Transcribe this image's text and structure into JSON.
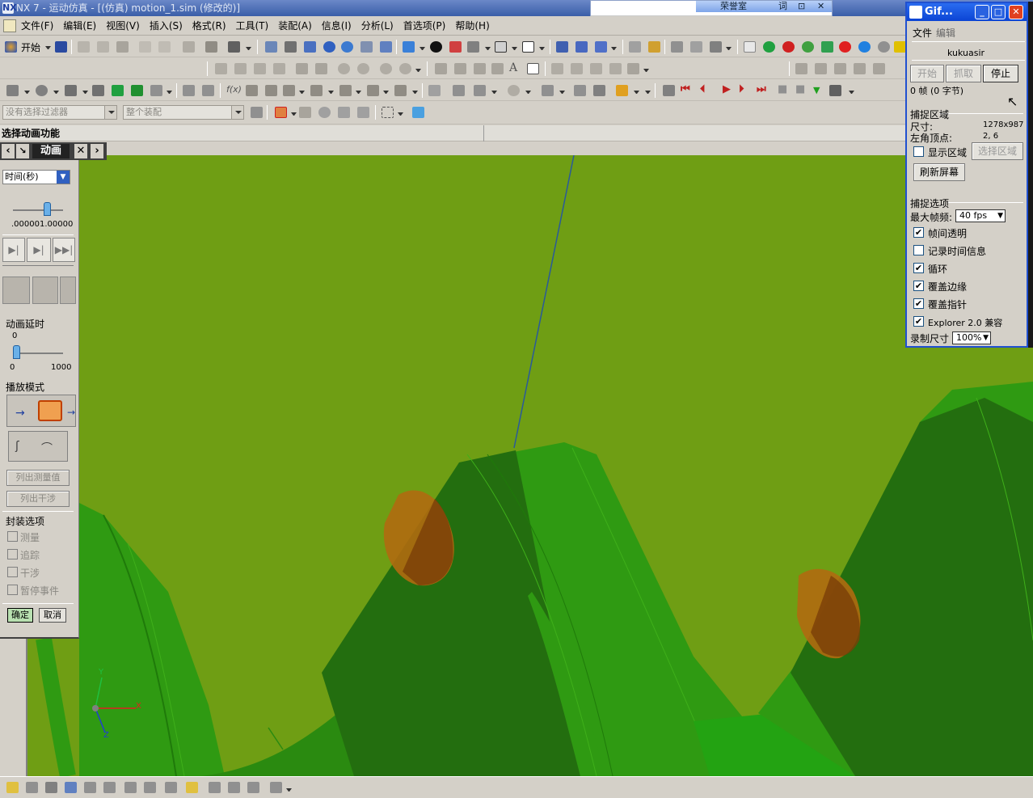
{
  "window": {
    "title": "NX 7 - 运动仿真 - [(仿真) motion_1.sim (修改的)]",
    "logo": "NX"
  },
  "menubar": {
    "items": [
      "文件(F)",
      "编辑(E)",
      "视图(V)",
      "插入(S)",
      "格式(R)",
      "工具(T)",
      "装配(A)",
      "信息(I)",
      "分析(L)",
      "首选项(P)",
      "帮助(H)"
    ]
  },
  "toolbar": {
    "start_label": "开始",
    "filter_combo": "没有选择过滤器",
    "scope_combo": "整个装配"
  },
  "overlay_top": {
    "tab1": "荣誉室",
    "tab2": "词",
    "tab3": "⊡"
  },
  "hint": {
    "text": "选择动画功能"
  },
  "panel": {
    "title": "动画",
    "time_combo": "时间(秒)",
    "time_slider_readout": ".000001.00000",
    "delay_label": "动画延时",
    "delay_value": "0",
    "delay_min": "0",
    "delay_max": "1000",
    "play_mode_label": "播放模式",
    "list_measure": "列出测量值",
    "list_interference": "列出干涉",
    "package_label": "封装选项",
    "opt_measure": "测量",
    "opt_trace": "追踪",
    "opt_interference": "干涉",
    "opt_pause": "暂停事件",
    "ok": "确定",
    "cancel": "取消",
    "colors": {
      "accent": "#404040",
      "ok_green": "#b8e0b0"
    }
  },
  "viewport": {
    "colors": {
      "background": "#6f9e14",
      "part_green": "#2f9a12",
      "shadow_green": "#236e0f",
      "marker": "#b06a10"
    },
    "axes": {
      "y": "Y",
      "x": "X",
      "z": "Z"
    }
  },
  "gif_recorder": {
    "title": "Gif...",
    "menu_file": "文件",
    "menu_edit": "编辑",
    "author": "kukuasir",
    "btn_start": "开始",
    "btn_grab": "抓取",
    "btn_stop": "停止",
    "frames_text": "0 帧 (0 字节)",
    "capture_area_label": "捕捉区域",
    "size_label": "尺寸:",
    "size_value": "1278x987",
    "origin_label": "左角顶点:",
    "origin_value": "2, 6",
    "show_area": "显示区域",
    "select_area": "选择区域",
    "refresh": "刷新屏幕",
    "capture_options_label": "捕捉选项",
    "max_fps_label": "最大帧频:",
    "max_fps_value": "40 fps",
    "opt_transparent": "帧间透明",
    "opt_timeinfo": "记录时间信息",
    "opt_loop": "循环",
    "opt_edge": "覆盖边缘",
    "opt_pointer": "覆盖指针",
    "opt_explorer": "Explorer 2.0 兼容",
    "record_size_label": "录制尺寸",
    "record_size_value": "100%",
    "checks": {
      "transparent": true,
      "timeinfo": false,
      "loop": true,
      "edge": true,
      "pointer": true,
      "explorer": true
    },
    "colors": {
      "titlebar": "#0b44d4",
      "close": "#e04020"
    }
  }
}
